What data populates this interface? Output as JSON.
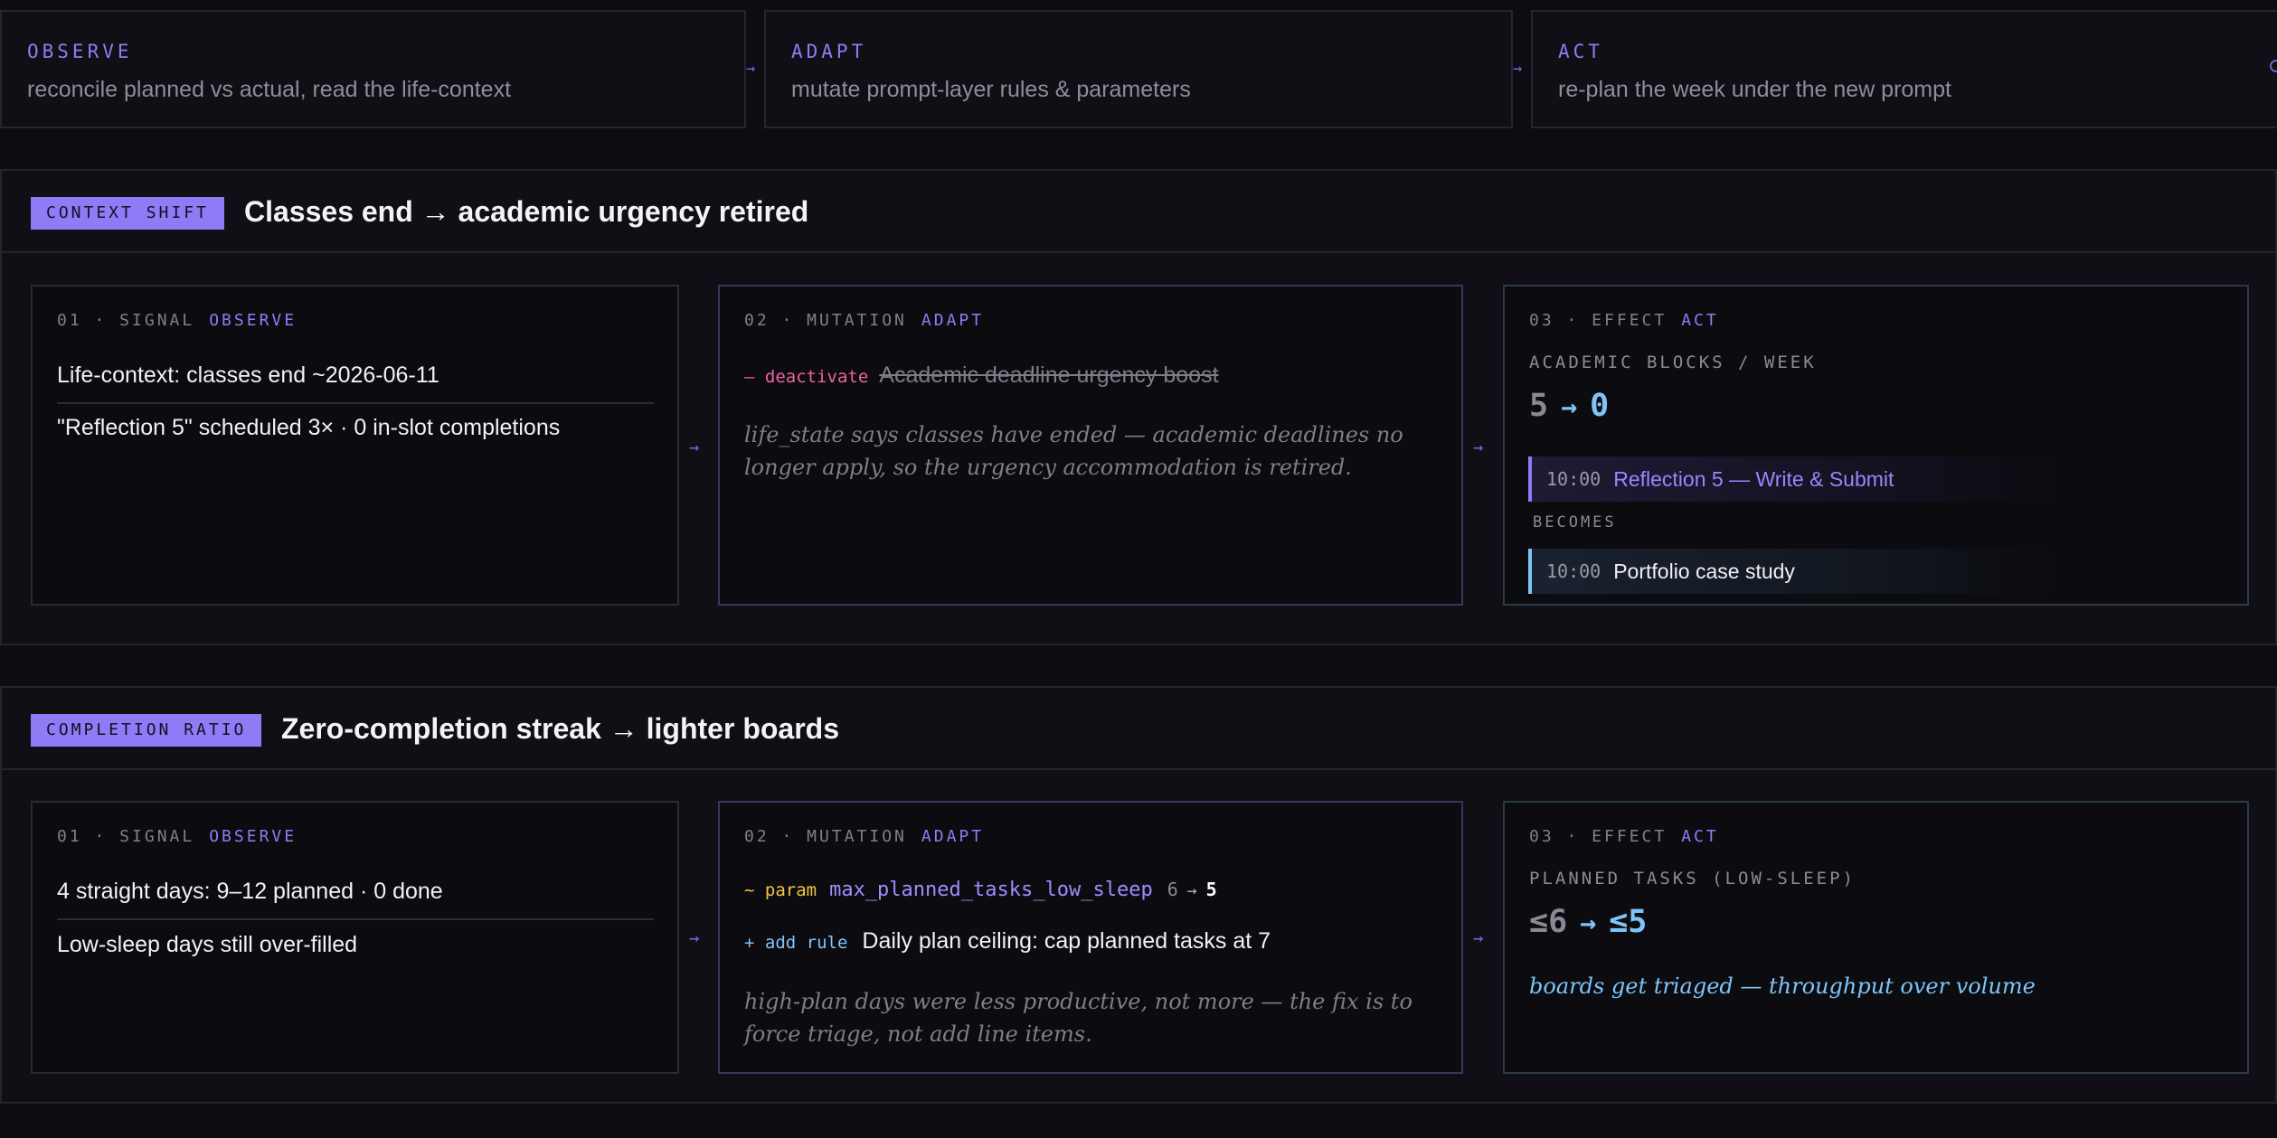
{
  "phases": [
    {
      "title": "OBSERVE",
      "desc": "reconcile planned vs actual, read the life-context"
    },
    {
      "title": "ADAPT",
      "desc": "mutate prompt-layer rules & parameters"
    },
    {
      "title": "ACT",
      "desc": "re-plan the week under the new prompt"
    }
  ],
  "arrow": "→",
  "sections": [
    {
      "badge": "CONTEXT SHIFT",
      "title": "Classes end → academic urgency retired",
      "signal": {
        "num": "01 · SIGNAL",
        "phase": "OBSERVE",
        "lines": [
          "Life-context: classes end ~2026-06-11",
          "\"Reflection 5\" scheduled 3× · 0 in-slot completions"
        ]
      },
      "mutation": {
        "num": "02 · MUTATION",
        "phase": "ADAPT",
        "tag": "– deactivate",
        "rule": "Academic deadline urgency boost",
        "note": "life_state says classes have ended — academic deadlines no longer apply, so the urgency accommodation is retired."
      },
      "effect": {
        "num": "03 · EFFECT",
        "phase": "ACT",
        "metric_label": "ACADEMIC BLOCKS / WEEK",
        "from": "5",
        "to": "0",
        "old_slot": {
          "time": "10:00",
          "text": "Reflection 5 — Write & Submit"
        },
        "becomes": "BECOMES",
        "new_slot": {
          "time": "10:00",
          "text": "Portfolio case study"
        }
      }
    },
    {
      "badge": "COMPLETION RATIO",
      "title": "Zero-completion streak → lighter boards",
      "signal": {
        "num": "01 · SIGNAL",
        "phase": "OBSERVE",
        "lines": [
          "4 straight days: 9–12 planned · 0 done",
          "Low-sleep days still over-filled"
        ]
      },
      "mutation": {
        "num": "02 · MUTATION",
        "phase": "ADAPT",
        "param_tag": "~ param",
        "param_name": "max_planned_tasks_low_sleep",
        "param_from": "6",
        "param_to": "5",
        "add_tag": "+ add rule",
        "add_text": "Daily plan ceiling: cap planned tasks at 7",
        "note": "high-plan days were less productive, not more — the fix is to force triage, not add line items."
      },
      "effect": {
        "num": "03 · EFFECT",
        "phase": "ACT",
        "metric_label": "PLANNED TASKS (LOW-SLEEP)",
        "from": "≤6",
        "to": "≤5",
        "note": "boards get triaged — throughput over volume"
      }
    }
  ]
}
